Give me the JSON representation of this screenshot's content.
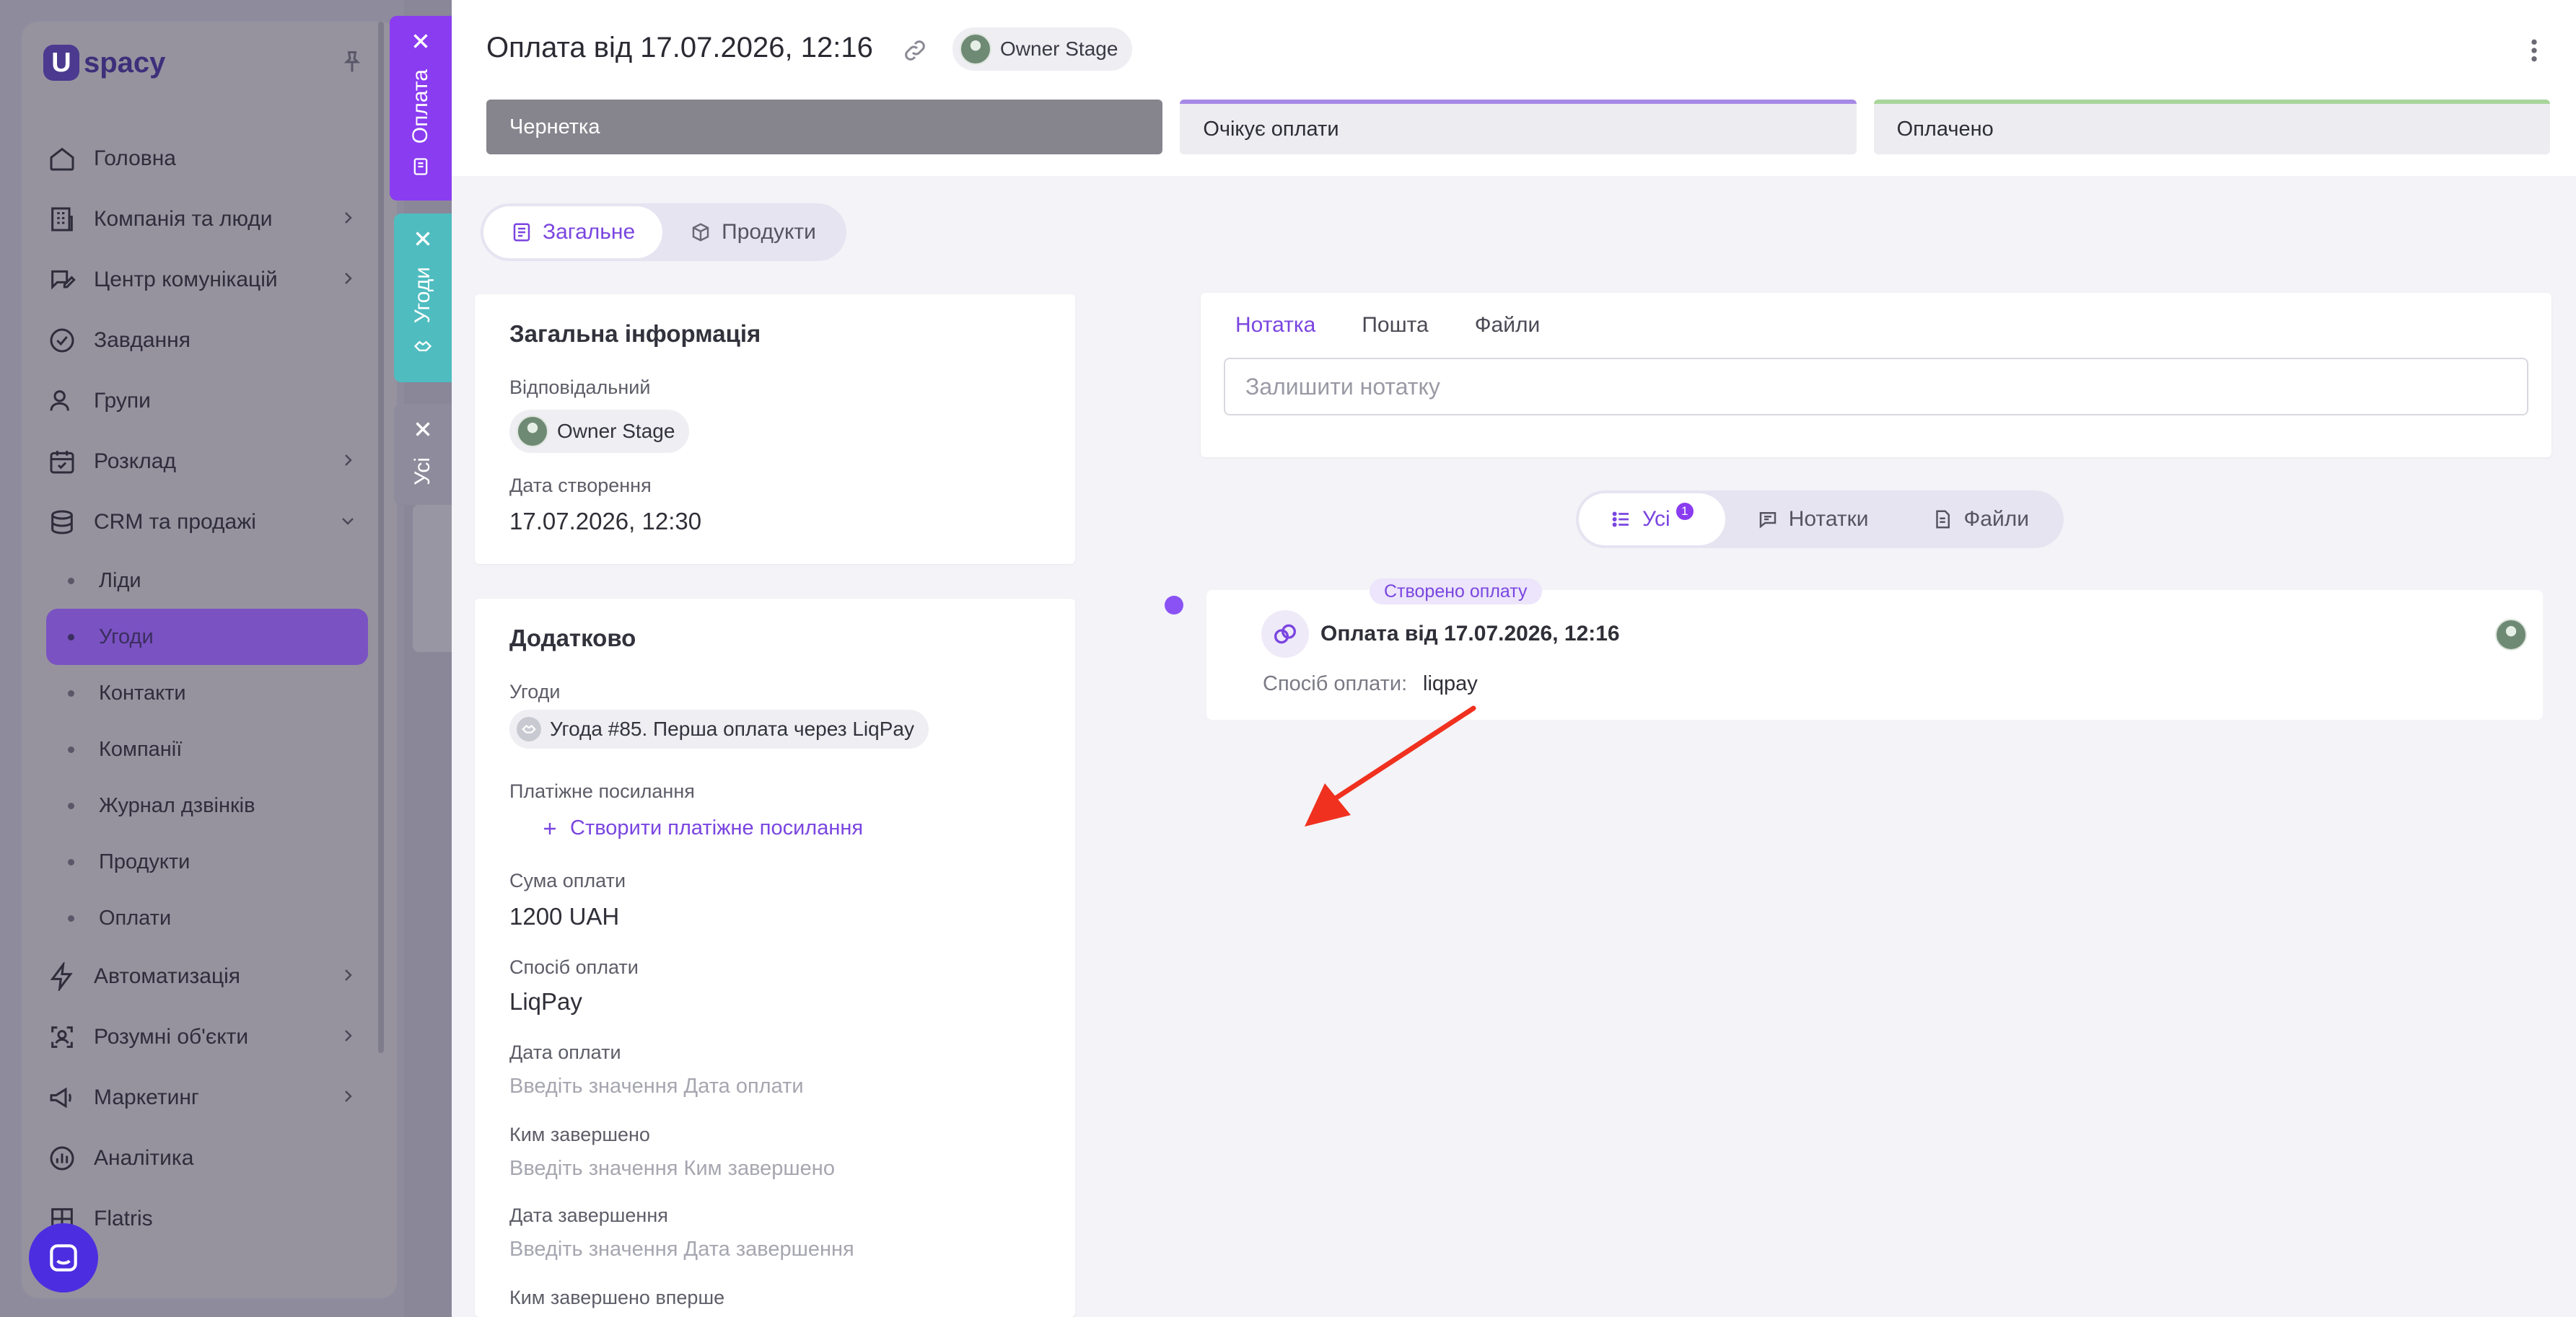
{
  "sidebar": {
    "logo_text": "spacy",
    "nav": [
      {
        "label": "Головна",
        "icon": "home-icon",
        "chevron": false
      },
      {
        "label": "Компанія та люди",
        "icon": "building-icon",
        "chevron": true
      },
      {
        "label": "Центр комунікацій",
        "icon": "chat-edit-icon",
        "chevron": true
      },
      {
        "label": "Завдання",
        "icon": "check-circle-icon",
        "chevron": false
      },
      {
        "label": "Групи",
        "icon": "users-icon",
        "chevron": false
      },
      {
        "label": "Розклад",
        "icon": "calendar-icon",
        "chevron": true
      },
      {
        "label": "CRM та продажі",
        "icon": "database-icon",
        "chevron": true
      }
    ],
    "crm_sub": [
      "Ліди",
      "Угоди",
      "Контакти",
      "Компанії",
      "Журнал дзвінків",
      "Продукти",
      "Оплати"
    ],
    "crm_active": "Угоди",
    "nav_bottom": [
      {
        "label": "Автоматизація",
        "icon": "lightning-icon",
        "chevron": true
      },
      {
        "label": "Розумні об'єкти",
        "icon": "scan-icon",
        "chevron": true
      },
      {
        "label": "Маркетинг",
        "icon": "megaphone-icon",
        "chevron": true
      },
      {
        "label": "Аналітика",
        "icon": "chart-icon",
        "chevron": false
      },
      {
        "label": "Flatris",
        "icon": "grid-icon",
        "chevron": false
      }
    ]
  },
  "side_tabs": {
    "payment": "Оплата",
    "deals": "Угоди",
    "all": "Усі"
  },
  "header": {
    "title": "Оплата від 17.07.2026, 12:16",
    "owner": "Owner Stage",
    "stages": [
      "Чернетка",
      "Очікує оплати",
      "Оплачено"
    ]
  },
  "tabs": {
    "general": "Загальне",
    "products": "Продукти"
  },
  "general_info": {
    "title": "Загальна інформація",
    "responsible_label": "Відповідальний",
    "responsible": "Owner Stage",
    "created_label": "Дата створення",
    "created": "17.07.2026, 12:30"
  },
  "additional": {
    "title": "Додатково",
    "deals_label": "Угоди",
    "deal": "Угода #85. Перша оплата через LiqPay",
    "link_label": "Платіжне посилання",
    "create_link": "Створити платіжне посилання",
    "amount_label": "Сума оплати",
    "amount": "1200 UAH",
    "method_label": "Спосіб оплати",
    "method": "LiqPay",
    "pay_date_label": "Дата оплати",
    "pay_date_ph": "Введіть значення Дата оплати",
    "completed_by_label": "Ким завершено",
    "completed_by_ph": "Введіть значення Ким завершено",
    "completed_date_label": "Дата завершення",
    "completed_date_ph": "Введіть значення Дата завершення",
    "first_completed_label": "Ким завершено вперше"
  },
  "notes": {
    "tabs": [
      "Нотатка",
      "Пошта",
      "Файли"
    ],
    "placeholder": "Залишити нотатку"
  },
  "filters": {
    "all": "Усі",
    "all_count": "1",
    "notes": "Нотатки",
    "files": "Файли"
  },
  "event": {
    "tag": "Створено оплату",
    "title": "Оплата від 17.07.2026, 12:16",
    "method_label": "Спосіб оплати:",
    "method": "liqpay"
  },
  "colors": {
    "accent": "#7a45e0",
    "payment_tab": "#8a3cf0",
    "deals_tab": "#4fbcc0",
    "annotation_arrow": "#f0311f"
  }
}
